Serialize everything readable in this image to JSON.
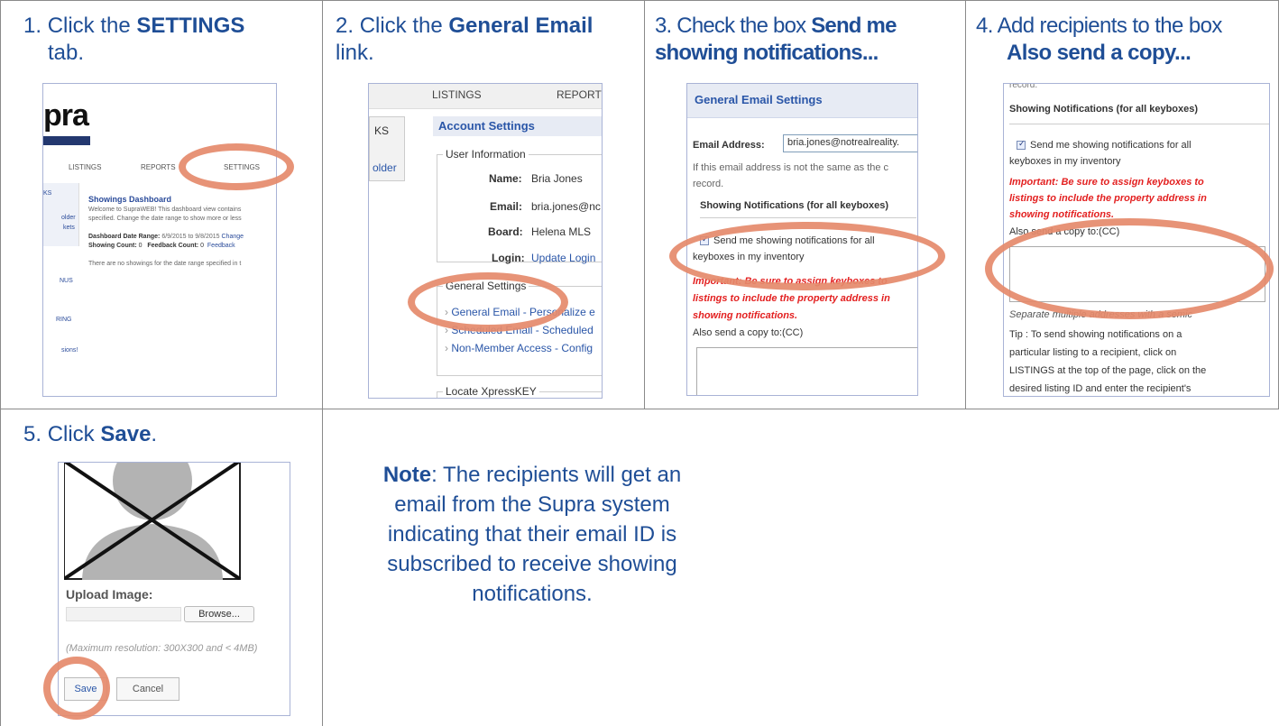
{
  "steps": [
    {
      "num": "1.",
      "pre": "Click the ",
      "bold": "SETTINGS",
      "post": " tab."
    },
    {
      "num": "2.",
      "pre": "Click the ",
      "bold": "General Email",
      "post": " link."
    },
    {
      "num": "3.",
      "pre": "Check the box ",
      "bold": "Send me showing notifications...",
      "post": ""
    },
    {
      "num": "4.",
      "pre": "Add recipients to the box ",
      "bold": "Also send a copy...",
      "post": ""
    },
    {
      "num": "5.",
      "pre": "Click ",
      "bold": "Save",
      "post": "."
    }
  ],
  "note": {
    "label": "Note",
    "text": ":  The recipients will get an email from the Supra system indicating that their email ID is subscribed to receive showing notifications."
  },
  "shot1": {
    "logo": "pra",
    "nav": [
      "LISTINGS",
      "REPORTS",
      "SETTINGS"
    ],
    "side": [
      "KS",
      "older",
      "kets",
      "NUS",
      "RING",
      "sions!"
    ],
    "dashboard_title": "Showings Dashboard",
    "line1": "Welcome to SupraWEB! This dashboard view contains",
    "line2": "specified. Change the date range to show more or less",
    "date_range_label": "Dashboard Date Range:",
    "date_range_value": "6/9/2015 to 9/8/2015",
    "change_link": "Change",
    "counts_label": "Showing Count:",
    "counts_value": "0",
    "feedback_label": "Feedback Count:",
    "feedback_value": "0",
    "feedback_link": "Feedback",
    "none_text": "There are no showings for the date range specified in t"
  },
  "shot2": {
    "nav": [
      "LISTINGS",
      "REPORT"
    ],
    "side": [
      "KS",
      "older"
    ],
    "header": "Account Settings",
    "user_info_legend": "User Information",
    "fields": [
      {
        "label": "Name:",
        "value": "Bria Jones"
      },
      {
        "label": "Email:",
        "value": "bria.jones@nc"
      },
      {
        "label": "Board:",
        "value": "Helena MLS"
      },
      {
        "label": "Login:",
        "value": "Update Login"
      }
    ],
    "general_legend": "General Settings",
    "links": [
      {
        "name": "General Email",
        "desc": " - Personalize e"
      },
      {
        "name": "Scheduled Email",
        "desc": " - Scheduled"
      },
      {
        "name": "Non-Member Access",
        "desc": " - Config"
      }
    ],
    "locate_legend": "Locate XpressKEY"
  },
  "shot3": {
    "header": "General Email Settings",
    "email_label": "Email Address:",
    "email_value": "bria.jones@notrealreality.",
    "note_line1": "If this email address is not the same as the c",
    "note_line2": "record.",
    "section": "Showing Notifications (for all keyboxes)",
    "checkbox_line1": "Send me showing notifications for all",
    "checkbox_line2": "keyboxes in my inventory",
    "important1": "Important: Be sure to assign keyboxes to",
    "important2": "listings to include the property address in",
    "important3": "showing notifications.",
    "cc_label": "Also send a copy to:(CC)"
  },
  "shot4": {
    "record": "record.",
    "section": "Showing Notifications (for all keyboxes)",
    "checkbox_line1": "Send me showing notifications for all",
    "checkbox_line2": "keyboxes in my inventory",
    "important1": "Important: Be sure to assign keyboxes to",
    "important2": "listings to include the property address in",
    "important3": "showing notifications.",
    "cc_label": "Also send a copy to:(CC)",
    "separate": "Separate multiple addresses with a semic",
    "tip1": "Tip : To send showing notifications on a",
    "tip2": "particular listing to a recipient, click on",
    "tip3": "LISTINGS at the top of the page, click on the",
    "tip4": "desired listing ID and enter the recipient's"
  },
  "shot5": {
    "upload_label": "Upload Image:",
    "browse": "Browse...",
    "max_res": "(Maximum resolution: 300X300 and < 4MB)",
    "save": "Save",
    "cancel": "Cancel"
  },
  "colors": {
    "accent": "#1f4e96",
    "highlight": "#e58a6b",
    "warning": "#e32020"
  }
}
